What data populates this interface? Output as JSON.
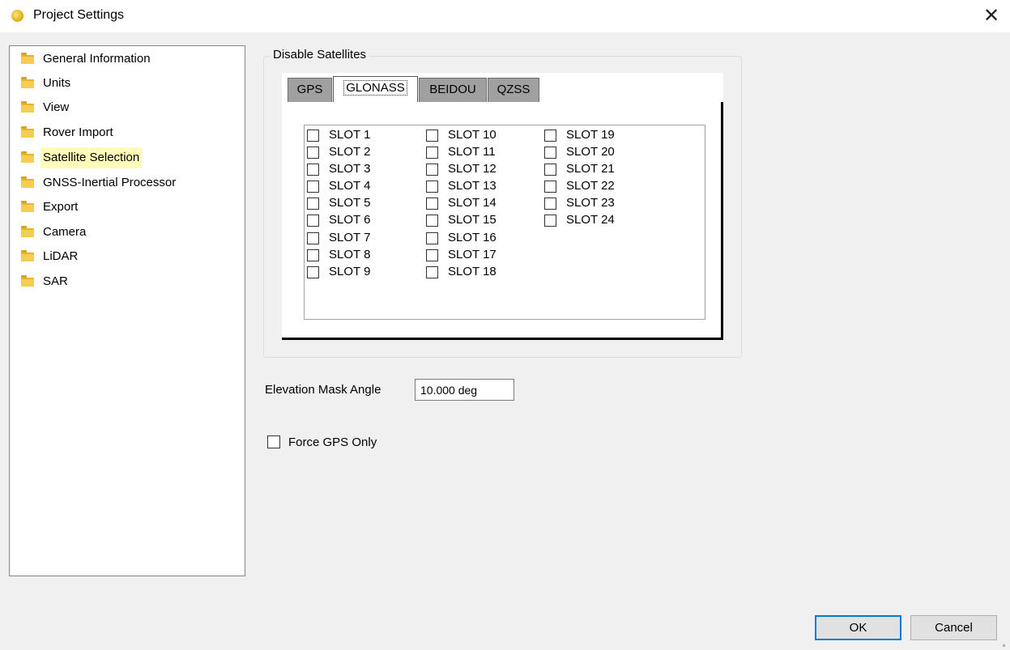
{
  "window": {
    "title": "Project Settings",
    "close_icon": "close-icon",
    "app_icon": "app-gear-icon"
  },
  "tree": {
    "selected_index": 4,
    "items": [
      {
        "label": "General Information",
        "icon": "folder-icon"
      },
      {
        "label": "Units",
        "icon": "folder-icon"
      },
      {
        "label": "View",
        "icon": "folder-icon"
      },
      {
        "label": "Rover Import",
        "icon": "folder-icon"
      },
      {
        "label": "Satellite Selection",
        "icon": "folder-icon"
      },
      {
        "label": "GNSS-Inertial Processor",
        "icon": "folder-icon"
      },
      {
        "label": "Export",
        "icon": "folder-icon"
      },
      {
        "label": "Camera",
        "icon": "folder-icon"
      },
      {
        "label": "LiDAR",
        "icon": "folder-icon"
      },
      {
        "label": "SAR",
        "icon": "folder-icon"
      }
    ]
  },
  "satellites": {
    "group_label": "Disable Satellites",
    "tabs": [
      {
        "label": "GPS",
        "active": false
      },
      {
        "label": "GLONASS",
        "active": true
      },
      {
        "label": "BEIDOU",
        "active": false
      },
      {
        "label": "QZSS",
        "active": false
      }
    ],
    "slots": [
      {
        "label": "SLOT 1",
        "checked": false
      },
      {
        "label": "SLOT 2",
        "checked": false
      },
      {
        "label": "SLOT 3",
        "checked": false
      },
      {
        "label": "SLOT 4",
        "checked": false
      },
      {
        "label": "SLOT 5",
        "checked": false
      },
      {
        "label": "SLOT 6",
        "checked": false
      },
      {
        "label": "SLOT 7",
        "checked": false
      },
      {
        "label": "SLOT 8",
        "checked": false
      },
      {
        "label": "SLOT 9",
        "checked": false
      },
      {
        "label": "SLOT 10",
        "checked": false
      },
      {
        "label": "SLOT 11",
        "checked": false
      },
      {
        "label": "SLOT 12",
        "checked": false
      },
      {
        "label": "SLOT 13",
        "checked": false
      },
      {
        "label": "SLOT 14",
        "checked": false
      },
      {
        "label": "SLOT 15",
        "checked": false
      },
      {
        "label": "SLOT 16",
        "checked": false
      },
      {
        "label": "SLOT 17",
        "checked": false
      },
      {
        "label": "SLOT 18",
        "checked": false
      },
      {
        "label": "SLOT 19",
        "checked": false
      },
      {
        "label": "SLOT 20",
        "checked": false
      },
      {
        "label": "SLOT 21",
        "checked": false
      },
      {
        "label": "SLOT 22",
        "checked": false
      },
      {
        "label": "SLOT 23",
        "checked": false
      },
      {
        "label": "SLOT 24",
        "checked": false
      }
    ]
  },
  "elevation": {
    "label": "Elevation Mask Angle",
    "value": "10.000 deg"
  },
  "force_gps": {
    "label": "Force GPS Only",
    "checked": false
  },
  "buttons": {
    "ok": "OK",
    "cancel": "Cancel"
  },
  "colors": {
    "selection_highlight": "#fffbb8",
    "focus_border": "#0078d7",
    "folder": "#f5cd51"
  }
}
